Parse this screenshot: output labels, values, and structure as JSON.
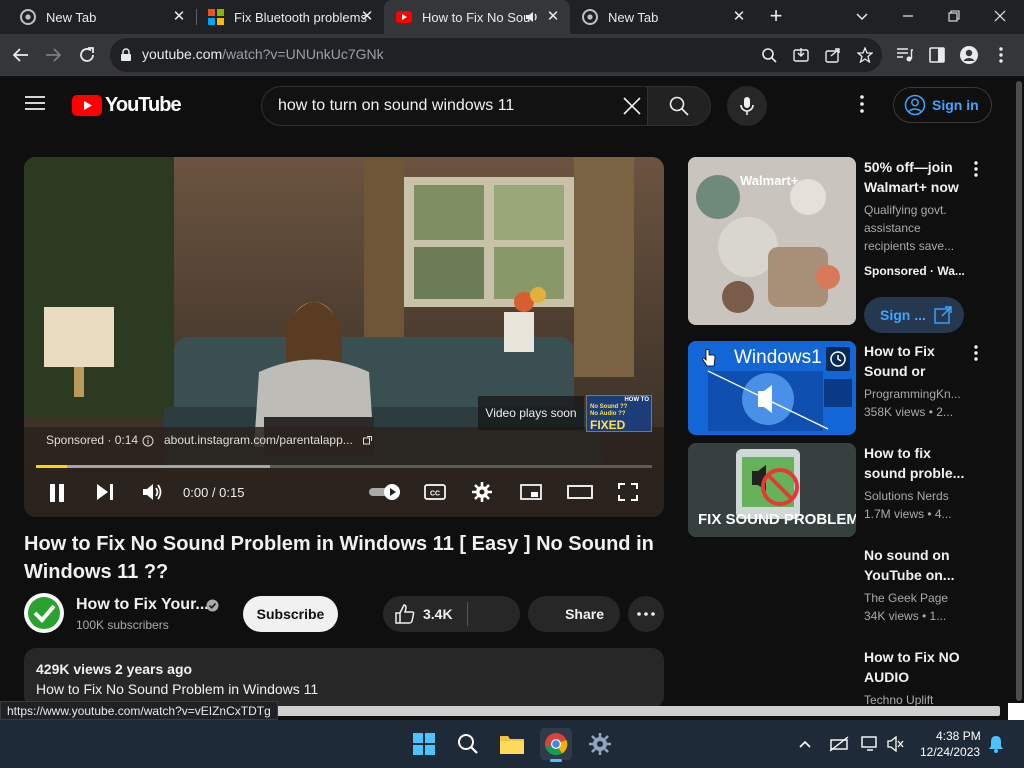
{
  "browser": {
    "tabs": [
      {
        "label": "New Tab",
        "icon": "chrome-icon"
      },
      {
        "label": "Fix Bluetooth problems",
        "icon": "windows-icon"
      },
      {
        "label": "How to Fix No Sou",
        "icon": "youtube-icon"
      },
      {
        "label": "New Tab",
        "icon": "chrome-icon"
      }
    ],
    "address": {
      "host": "youtube.com",
      "path": "/watch?v=UNUnkUc7GNk"
    }
  },
  "youtube": {
    "logo_text": "YouTube",
    "search_query": "how to turn on sound windows 11",
    "sign_in": "Sign in"
  },
  "player": {
    "sponsored": "Sponsored · 0:14",
    "ad_url": "about.instagram.com/parentalapp...",
    "video_plays_soon": "Video plays soon",
    "time": "0:00 / 0:15",
    "progress": 0.05,
    "buffer": 0.38,
    "next_thumb_lines": [
      "HOW TO",
      "No Sound ??",
      "No Audio ??",
      "FIXED"
    ]
  },
  "video": {
    "title": "How to Fix No Sound Problem in Windows 11 [ Easy ] No Sound in Windows 11 ??",
    "channel": "How to Fix Your...",
    "subscribers": "100K subscribers",
    "subscribe": "Subscribe",
    "likes": "3.4K",
    "share": "Share",
    "views": "429K views",
    "age": "2 years ago",
    "description": "How to Fix No Sound Problem in Windows 11"
  },
  "sidebar": [
    {
      "title": "50% off—join Walmart+ now",
      "meta1": "Qualifying govt. assistance recipients save...",
      "meta2": "Sponsored · Wa...",
      "button": "Sign ...",
      "thumb_text": "Walmart+"
    },
    {
      "title": "How to Fix Sound or Audi...",
      "meta1": "ProgrammingKn...",
      "meta2": "358K views • 2...",
      "thumb_text": "Windows1"
    },
    {
      "title": "How to fix sound proble...",
      "meta1": "Solutions Nerds",
      "meta2": "1.7M views • 4...",
      "thumb_text": "FIX SOUND PROBLEM"
    },
    {
      "title": "No sound on YouTube on...",
      "meta1": "The Geek Page",
      "meta2": "34K views • 1..."
    },
    {
      "title": "How to Fix NO AUDIO Device...",
      "meta1": "Techno Uplift"
    }
  ],
  "status_url": "https://www.youtube.com/watch?v=vEIZnCxTDTg",
  "taskbar": {
    "time": "4:38 PM",
    "date": "12/24/2023"
  },
  "colors": {
    "youtube_red": "#ff0000",
    "link_blue": "#3ea6ff",
    "taskbar": "#1f2a38"
  }
}
